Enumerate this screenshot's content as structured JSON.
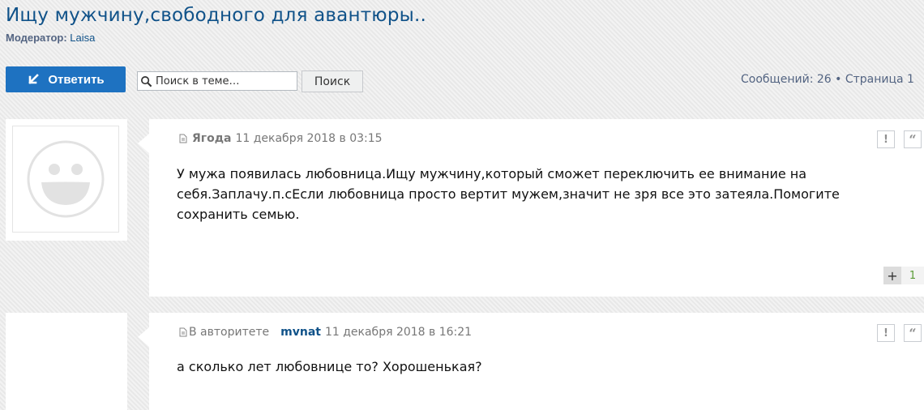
{
  "topic": {
    "title": "Ищу мужчину,свободного для авантюры..",
    "moderator_label": "Модератор:",
    "moderator_name": "Laisa"
  },
  "toolbar": {
    "reply_label": "Ответить",
    "search_placeholder": "Поиск в теме…",
    "search_button": "Поиск",
    "pagination": "Сообщений: 26 • Страница 1"
  },
  "posts": [
    {
      "author": "Ягода",
      "rank": "",
      "datetime": "11 декабря 2018 в 03:15",
      "body": "У мужа появилась любовница.Ищу мужчину,который сможет переключить ее внимание на себя.Заплачу.п.сЕсли любовница просто вертит мужем,значит не зря все это затеяла.Помогите сохранить семью.",
      "vote_plus": "+",
      "vote_count": "1"
    },
    {
      "author": "mvnat",
      "rank": "В авторитете",
      "datetime": "11 декабря 2018 в 16:21",
      "body": "а сколько лет любовнице то? Хорошенькая?"
    }
  ],
  "icons": {
    "reply": "reply-arrow-icon",
    "search": "magnifier-icon",
    "post": "document-icon",
    "report": "exclamation-icon",
    "quote": "quote-icon",
    "avatar": "smiley-placeholder-icon"
  },
  "colors": {
    "accent": "#1e72c1",
    "title": "#105289",
    "muted": "#536482",
    "vote_positive": "#5b9b36"
  }
}
